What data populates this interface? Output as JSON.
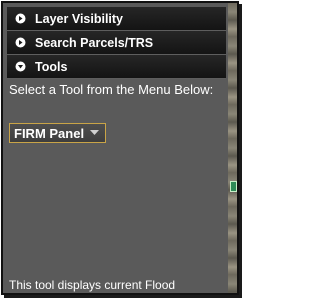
{
  "accordion": {
    "headers": [
      {
        "label": "Layer Visibility",
        "icon": "expand-circle-icon"
      },
      {
        "label": "Search Parcels/TRS",
        "icon": "expand-circle-icon"
      },
      {
        "label": "Tools",
        "icon": "expand-circle-icon"
      }
    ]
  },
  "tools": {
    "instruction": "Select a Tool from the Menu Below:",
    "selected_tool": "FIRM Panel",
    "description": "This tool displays current Flood"
  },
  "colors": {
    "header_bg": "#1c1c1c",
    "panel_bg": "#5a5a5a",
    "dropdown_border": "#c9a447"
  }
}
